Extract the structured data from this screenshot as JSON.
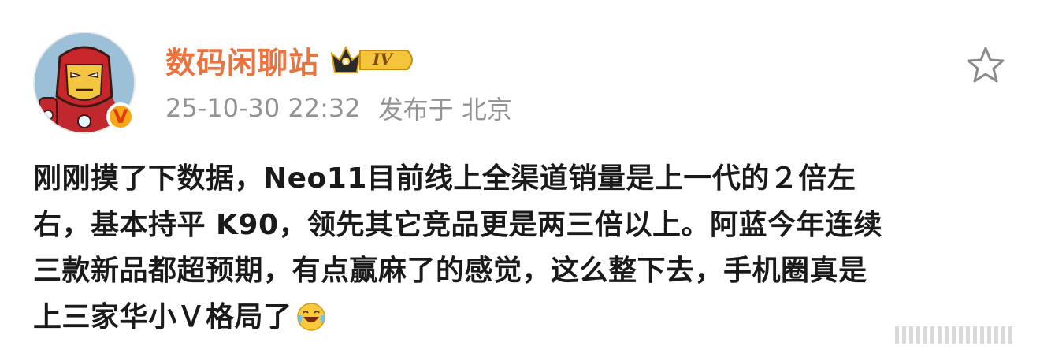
{
  "author": {
    "name": "数码闲聊站",
    "level_badge": "IV",
    "verified_mark": "V",
    "avatar": "iron-man-cartoon-avatar"
  },
  "meta": {
    "timestamp": "25-10-30 22:32",
    "location_label": "发布于 北京"
  },
  "actions": {
    "favorite_icon": "star-outline-icon"
  },
  "post": {
    "lines": [
      "刚刚摸了下数据，Neo11目前线上全渠道销量是上一代的２倍左",
      "右，基本持平 K90，领先其它竞品更是两三倍以上。阿蓝今年连续",
      "三款新品都超预期，有点赢麻了的感觉，这么整下去，手机圈真是",
      "上三家华小Ｖ格局了"
    ],
    "emoji": "laughing-crying-emoji"
  },
  "colors": {
    "username": "#eb7340",
    "meta": "#939393",
    "body": "#1a1a1a",
    "badge_gold": "#f7a816"
  }
}
